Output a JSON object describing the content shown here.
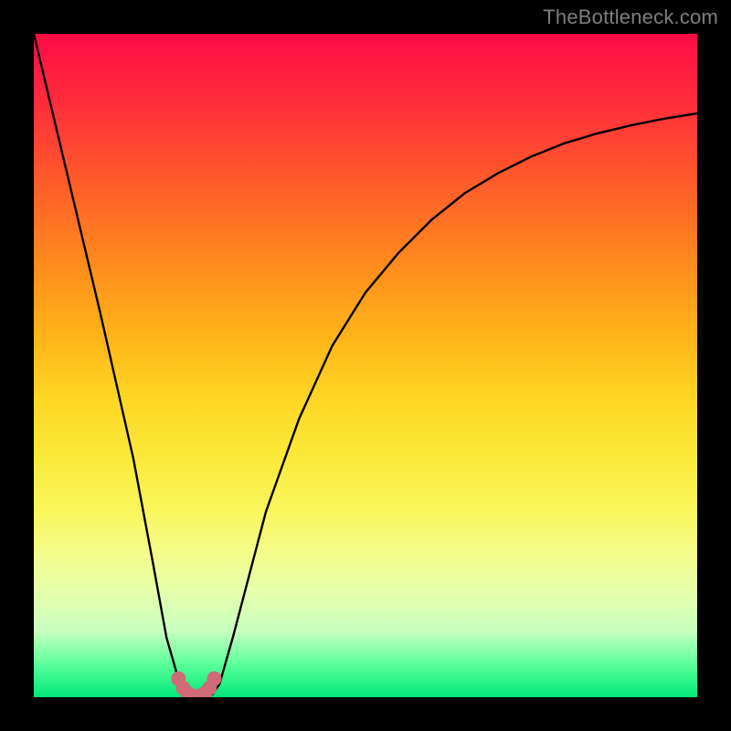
{
  "watermark": "TheBottleneck.com",
  "chart_data": {
    "type": "line",
    "title": "",
    "xlabel": "",
    "ylabel": "",
    "xlim": [
      0,
      100
    ],
    "ylim": [
      0,
      100
    ],
    "grid": false,
    "series": [
      {
        "name": "bottleneck-curve",
        "x": [
          0,
          5,
          10,
          15,
          18,
          20,
          22,
          23,
          24,
          25,
          26,
          27,
          28,
          30,
          35,
          40,
          45,
          50,
          55,
          60,
          65,
          70,
          75,
          80,
          85,
          90,
          95,
          100
        ],
        "values": [
          100,
          79,
          58,
          36,
          20,
          9,
          2,
          0.5,
          0,
          0,
          0,
          0.5,
          2,
          9,
          28,
          42,
          53,
          61,
          67,
          72,
          76,
          79,
          81.5,
          83.5,
          85,
          86.2,
          87.2,
          88
        ]
      },
      {
        "name": "highlight-dots",
        "x": [
          21.8,
          22.5,
          23.2,
          24,
          25,
          25.8,
          26.5,
          27.2
        ],
        "values": [
          2.8,
          1.4,
          0.6,
          0.2,
          0.2,
          0.6,
          1.4,
          2.8
        ]
      }
    ],
    "colors": {
      "curve": "#000000",
      "highlight": "#cf6a76"
    }
  }
}
